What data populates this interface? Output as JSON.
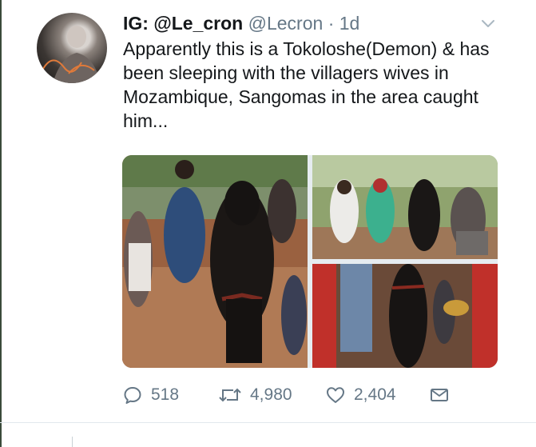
{
  "tweet": {
    "display_name": "IG: @Le_cron",
    "handle": "@Lecron",
    "separator": "·",
    "time": "1d",
    "text": "Apparently this is a Tokoloshe(Demon) & has been sleeping with the villagers wives in Mozambique, Sangomas in the area caught him..."
  },
  "actions": {
    "replies": "518",
    "retweets": "4,980",
    "likes": "2,404"
  },
  "icons": {
    "menu": "chevron-down-icon",
    "reply": "reply-icon",
    "retweet": "retweet-icon",
    "like": "heart-icon",
    "dm": "envelope-icon"
  },
  "colors": {
    "text": "#14171a",
    "muted": "#657786",
    "divider": "#e1e8ed"
  }
}
